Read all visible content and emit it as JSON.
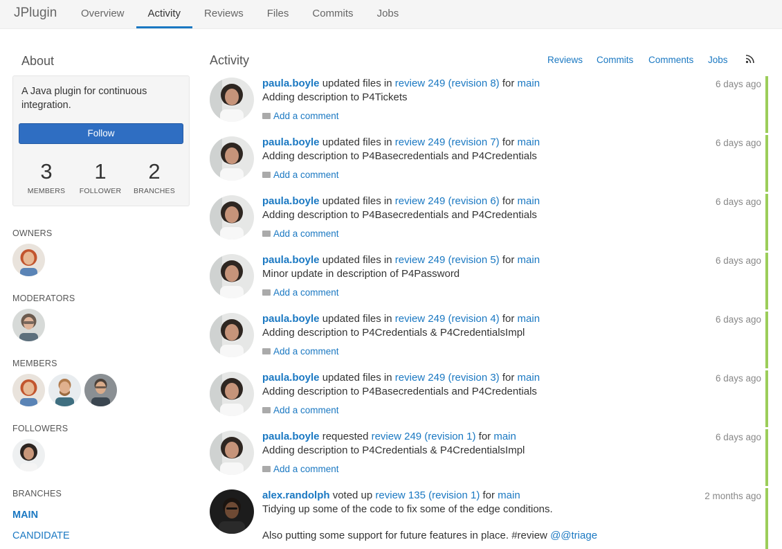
{
  "nav": {
    "brand": "JPlugin",
    "tabs": [
      "Overview",
      "Activity",
      "Reviews",
      "Files",
      "Commits",
      "Jobs"
    ]
  },
  "about": {
    "title": "About",
    "description": "A Java plugin for continuous integration.",
    "follow_label": "Follow",
    "stats": [
      {
        "value": "3",
        "label": "MEMBERS"
      },
      {
        "value": "1",
        "label": "FOLLOWER"
      },
      {
        "value": "2",
        "label": "BRANCHES"
      }
    ]
  },
  "sections": {
    "owners": "OWNERS",
    "moderators": "MODERATORS",
    "members": "MEMBERS",
    "followers": "FOLLOWERS",
    "branches": "BRANCHES"
  },
  "branches": [
    "MAIN",
    "CANDIDATE"
  ],
  "activity": {
    "title": "Activity",
    "filters": [
      "Reviews",
      "Commits",
      "Comments",
      "Jobs"
    ],
    "add_comment": "Add a comment",
    "entries": [
      {
        "user": "paula.boyle",
        "action": " updated files in ",
        "target": "review 249 (revision 8)",
        "for": " for ",
        "branch": "main",
        "message": "Adding description to P4Tickets",
        "time": "6 days ago"
      },
      {
        "user": "paula.boyle",
        "action": " updated files in ",
        "target": "review 249 (revision 7)",
        "for": " for ",
        "branch": "main",
        "message": "Adding description to P4Basecredentials and P4Credentials",
        "time": "6 days ago"
      },
      {
        "user": "paula.boyle",
        "action": " updated files in ",
        "target": "review 249 (revision 6)",
        "for": " for ",
        "branch": "main",
        "message": "Adding description to P4Basecredentials and P4Credentials",
        "time": "6 days ago"
      },
      {
        "user": "paula.boyle",
        "action": " updated files in ",
        "target": "review 249 (revision 5)",
        "for": " for ",
        "branch": "main",
        "message": "Minor update in description of P4Password",
        "time": "6 days ago"
      },
      {
        "user": "paula.boyle",
        "action": " updated files in ",
        "target": "review 249 (revision 4)",
        "for": " for ",
        "branch": "main",
        "message": "Adding description to P4Credentials & P4CredentialsImpl",
        "time": "6 days ago"
      },
      {
        "user": "paula.boyle",
        "action": " updated files in ",
        "target": "review 249 (revision 3)",
        "for": " for ",
        "branch": "main",
        "message": "Adding description to P4Basecredentials and P4Credentials",
        "time": "6 days ago"
      },
      {
        "user": "paula.boyle",
        "action": " requested ",
        "target": "review 249 (revision 1)",
        "for": " for ",
        "branch": "main",
        "message": "Adding description to P4Credentials & P4CredentialsImpl",
        "time": "6 days ago"
      },
      {
        "user": "alex.randolph",
        "action": " voted up ",
        "target": "review 135 (revision 1)",
        "for": " for ",
        "branch": "main",
        "message": "Tidying up some of the code to fix some of the edge conditions.",
        "message2": "Also putting some support for future features in place. #review ",
        "mention": "@@triage",
        "time": "2 months ago"
      }
    ]
  },
  "colors": {
    "accent": "#1a78c2",
    "follow_button": "#2f6ec2",
    "status_bar": "#9ccd5a"
  }
}
